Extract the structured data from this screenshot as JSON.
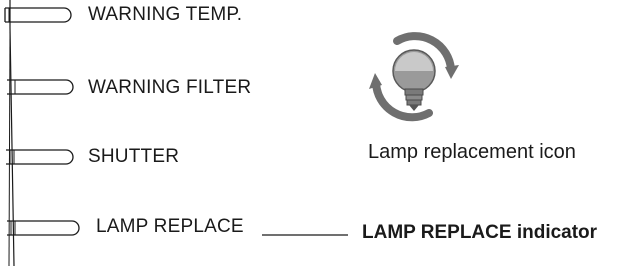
{
  "indicators": [
    {
      "id": "warning-temp",
      "label": "WARNING TEMP."
    },
    {
      "id": "warning-filter",
      "label": "WARNING FILTER"
    },
    {
      "id": "shutter",
      "label": "SHUTTER"
    },
    {
      "id": "lamp-replace",
      "label": "LAMP REPLACE"
    }
  ],
  "icon": {
    "name": "lamp-replacement-icon",
    "caption": "Lamp replacement icon"
  },
  "callout": {
    "label": "LAMP REPLACE indicator"
  },
  "colors": {
    "ink": "#1a1a1a",
    "icon_gray": "#8a8a8a",
    "icon_dark": "#555555"
  }
}
